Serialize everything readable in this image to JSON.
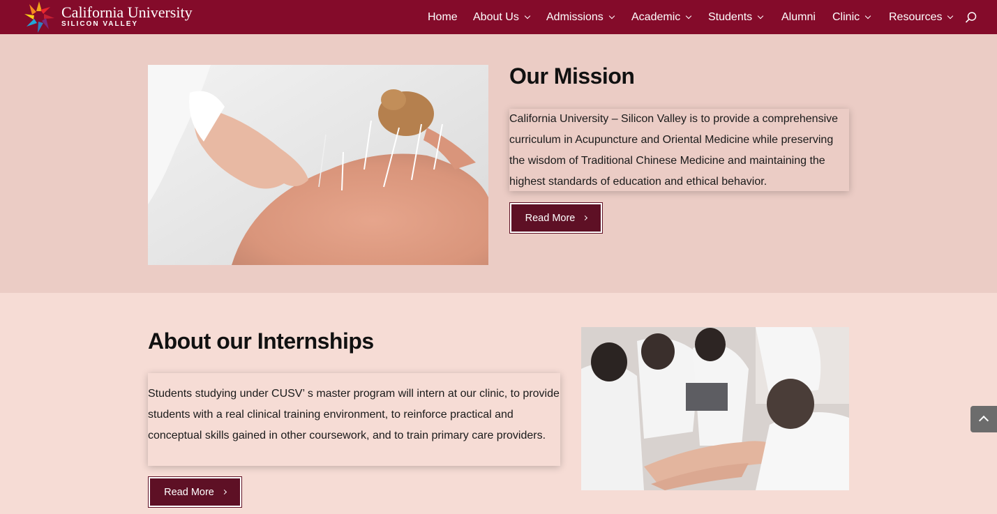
{
  "header": {
    "logo_name": "California University",
    "logo_sub": "SILICON VALLEY",
    "nav": [
      {
        "label": "Home",
        "dropdown": false
      },
      {
        "label": "About Us",
        "dropdown": true
      },
      {
        "label": "Admissions",
        "dropdown": true
      },
      {
        "label": "Academic",
        "dropdown": true
      },
      {
        "label": "Students",
        "dropdown": true
      },
      {
        "label": "Alumni",
        "dropdown": false
      },
      {
        "label": "Clinic",
        "dropdown": true
      },
      {
        "label": "Resources",
        "dropdown": true
      }
    ],
    "search_icon": "search-icon"
  },
  "mission": {
    "title": "Our Mission",
    "text": "California University – Silicon Valley is to provide a comprehensive curriculum in Acupuncture and Oriental Medicine while preserving the wisdom of Traditional Chinese Medicine and maintaining the highest standards of education and ethical behavior.",
    "button": "Read More"
  },
  "internships": {
    "title": "About our Internships",
    "text": "Students studying under CUSV’ s master program will intern at our clinic, to provide students with a real clinical training environment, to reinforce practical and conceptual skills gained in other coursework, and to train primary care providers.",
    "button": "Read More"
  },
  "colors": {
    "header_bg": "#840b2a",
    "section1_bg": "#ebccc5",
    "section2_bg": "#f6dcd5",
    "button_bg": "#5e1025"
  },
  "icons": {
    "back_to_top": "chevron-up-icon"
  }
}
